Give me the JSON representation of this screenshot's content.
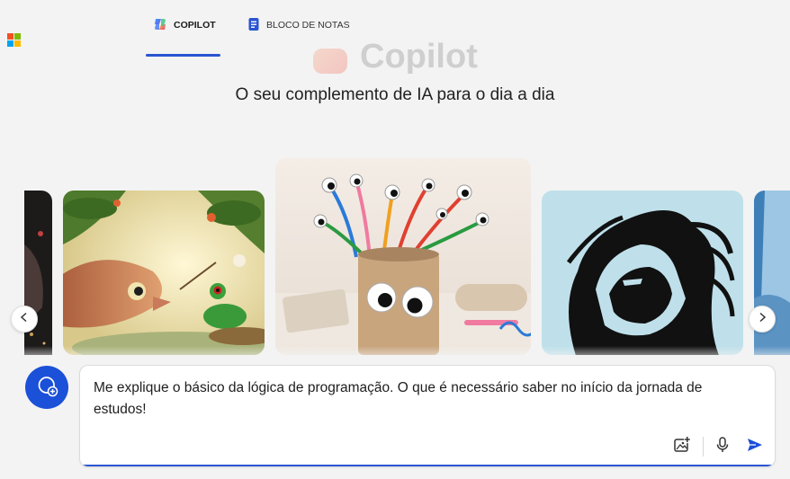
{
  "header": {
    "logo_icon": "microsoft-logo-icon",
    "logo_colors": [
      "#f25022",
      "#7fba00",
      "#00a4ef",
      "#ffb900"
    ],
    "tabs": [
      {
        "label": "COPILOT",
        "icon": "copilot-icon",
        "active": true
      },
      {
        "label": "BLOCO DE NOTAS",
        "icon": "notebook-icon",
        "active": false
      }
    ],
    "accent": "#2a54d2"
  },
  "hero": {
    "title": "Copilot",
    "subtitle": "O seu complemento de IA para o dia a dia"
  },
  "carousel": {
    "items": [
      {
        "subject": "partial-dark-image"
      },
      {
        "subject": "fish-and-frog-illustration"
      },
      {
        "subject": "googly-eyed-craft-tube-photo"
      },
      {
        "subject": "lion-silhouette-illustration"
      },
      {
        "subject": "partial-blue-image"
      }
    ],
    "prev_icon": "chevron-left-icon",
    "next_icon": "chevron-right-icon"
  },
  "composer": {
    "new_topic_icon": "new-topic-chat-icon",
    "text": "Me explique o básico da lógica de programação. O que é necessário saber no início da jornada de estudos!",
    "tools": [
      "add-image-icon",
      "microphone-icon",
      "send-icon"
    ],
    "brand_color": "#1b50d8"
  }
}
